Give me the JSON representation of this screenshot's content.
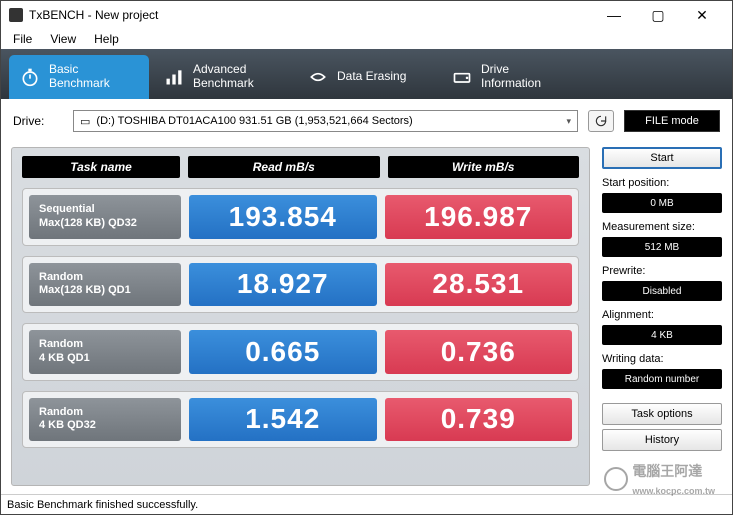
{
  "window": {
    "title": "TxBENCH - New project"
  },
  "menubar": [
    "File",
    "View",
    "Help"
  ],
  "tabs": [
    {
      "label1": "Basic",
      "label2": "Benchmark",
      "icon": "stopwatch-icon",
      "active": true
    },
    {
      "label1": "Advanced",
      "label2": "Benchmark",
      "icon": "bars-icon",
      "active": false
    },
    {
      "label1": "Data Erasing",
      "label2": "",
      "icon": "erase-icon",
      "active": false
    },
    {
      "label1": "Drive",
      "label2": "Information",
      "icon": "drive-icon",
      "active": false
    }
  ],
  "drive": {
    "label": "Drive:",
    "selected": "(D:) TOSHIBA DT01ACA100  931.51 GB (1,953,521,664 Sectors)",
    "file_mode": "FILE mode"
  },
  "columns": {
    "name": "Task name",
    "read": "Read mB/s",
    "write": "Write mB/s"
  },
  "rows": [
    {
      "task1": "Sequential",
      "task2": "Max(128 KB) QD32",
      "read": "193.854",
      "write": "196.987"
    },
    {
      "task1": "Random",
      "task2": "Max(128 KB) QD1",
      "read": "18.927",
      "write": "28.531"
    },
    {
      "task1": "Random",
      "task2": "4 KB QD1",
      "read": "0.665",
      "write": "0.736"
    },
    {
      "task1": "Random",
      "task2": "4 KB QD32",
      "read": "1.542",
      "write": "0.739"
    }
  ],
  "side": {
    "start": "Start",
    "start_pos_lbl": "Start position:",
    "start_pos_val": "0 MB",
    "meas_size_lbl": "Measurement size:",
    "meas_size_val": "512 MB",
    "prewrite_lbl": "Prewrite:",
    "prewrite_val": "Disabled",
    "align_lbl": "Alignment:",
    "align_val": "4 KB",
    "wdata_lbl": "Writing data:",
    "wdata_val": "Random number",
    "task_opts": "Task options",
    "history": "History"
  },
  "status": "Basic Benchmark finished successfully.",
  "watermark": "電腦王阿達",
  "watermark_url": "www.kocpc.com.tw"
}
